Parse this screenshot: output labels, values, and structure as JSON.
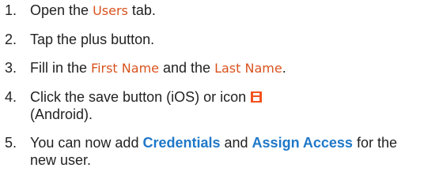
{
  "steps": [
    {
      "num": "1.",
      "parts": [
        "Open the ",
        "Users",
        " tab."
      ]
    },
    {
      "num": "2.",
      "parts": [
        "Tap the plus button."
      ]
    },
    {
      "num": "3.",
      "parts": [
        "Fill in the ",
        "First Name",
        " and the ",
        "Last Name",
        "."
      ]
    },
    {
      "num": "4.",
      "parts": [
        "Click the save button (iOS) or icon ",
        " (Android)."
      ],
      "icon": "save-icon"
    },
    {
      "num": "5.",
      "parts": [
        "You can now add ",
        "Credentials",
        " and ",
        "Assign Access",
        " for the new user."
      ]
    }
  ],
  "colors": {
    "ui_term": "#d9531e",
    "link": "#1f78c8",
    "icon": "#f4511e"
  }
}
